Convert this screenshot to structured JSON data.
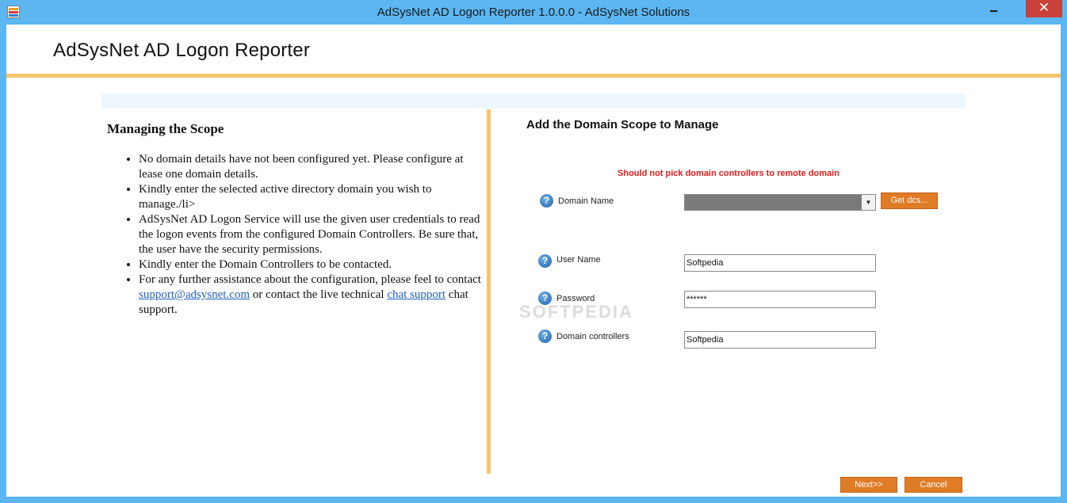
{
  "window": {
    "title": "AdSysNet AD Logon Reporter 1.0.0.0 - AdSysNet Solutions",
    "close_symbol": "✕"
  },
  "header": {
    "app_heading": "AdSysNet AD Logon Reporter"
  },
  "left_panel": {
    "title": "Managing the Scope",
    "items": [
      {
        "text": "No domain details have not been configured yet. Please configure at lease one domain details."
      },
      {
        "text": "Kindly enter the selected active directory domain you wish to manage./li>"
      },
      {
        "text": "AdSysNet AD Logon Service will use the given user credentials to read the logon events from the configured Domain Controllers. Be sure that, the user have the security permissions."
      },
      {
        "text": "Kindly enter the Domain Controllers to be contacted."
      },
      {
        "text_before": "For any further assistance about the configuration, please feel to contact ",
        "email_link": "support@adsysnet.com",
        "text_middle": " or contact the live technical ",
        "chat_link": "chat support",
        "text_after": " chat support."
      }
    ]
  },
  "right_panel": {
    "title": "Add the Domain Scope to Manage",
    "warning": "Should not pick domain controllers to remote domain",
    "help_glyph": "?",
    "fields": {
      "domain_name": {
        "label": "Domain Name",
        "value": ""
      },
      "user_name": {
        "label": "User Name",
        "value": "Softpedia"
      },
      "password": {
        "label": "Password",
        "value": "******"
      },
      "domain_controllers": {
        "label": "Domain controllers",
        "value": "Softpedia"
      }
    },
    "get_dcs_label": "Get dcs...",
    "combo_arrow": "▼",
    "watermark": "SOFTPEDIA"
  },
  "footer": {
    "next_label": "Next>>",
    "cancel_label": "Cancel"
  },
  "colors": {
    "accent": "#f6c46f",
    "button": "#e07b26",
    "warning": "#e11b1b",
    "titlebar": "#5bb6f2"
  }
}
